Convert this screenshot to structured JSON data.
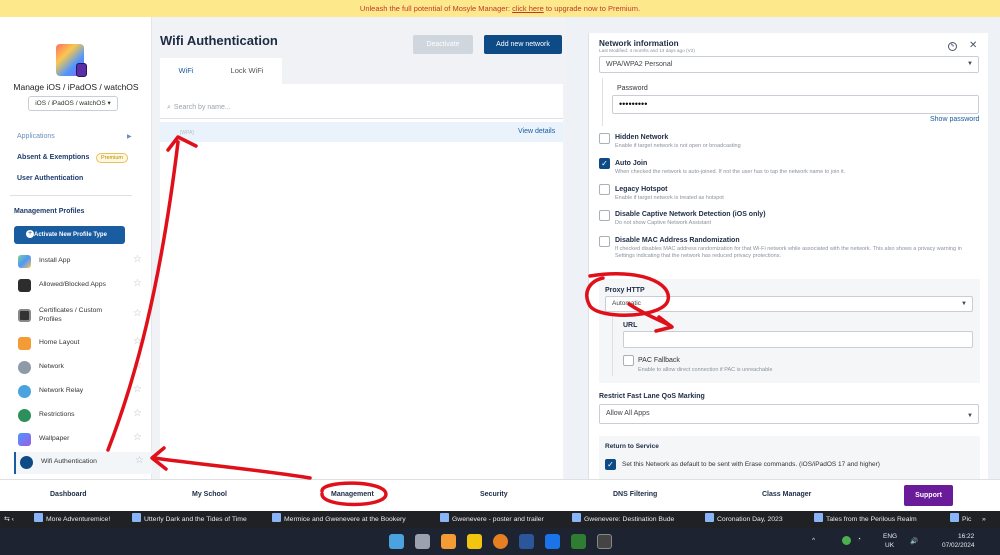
{
  "banner": {
    "pre": "Unleash the full potential of Mosyle Manager: ",
    "link": "click here",
    "post": " to upgrade now to Premium."
  },
  "sidebar": {
    "title": "Manage iOS / iPadOS / watchOS",
    "select": "iOS / iPadOS / watchOS",
    "links": [
      "Applications",
      "Absent & Exemptions",
      "User Authentication"
    ],
    "premium": "Premium",
    "mgmt_title": "Management Profiles",
    "activate": "Activate New Profile Type",
    "items": [
      "Install App",
      "Allowed/Blocked Apps",
      "Certificates / Custom Profiles",
      "Home Layout",
      "Network",
      "Network Relay",
      "Restrictions",
      "Wallpaper",
      "Wifi Authentication"
    ]
  },
  "center": {
    "title": "Wifi Authentication",
    "deactivate": "Deactivate",
    "add": "Add new network",
    "tabs": [
      "WiFi",
      "Lock WiFi"
    ],
    "search_placeholder": "Search by name...",
    "row_name": "[WPA]",
    "view_details": "View details"
  },
  "right": {
    "title": "Network information",
    "subtitle": "Last Modified: 4 months and 13 days ago (V2)",
    "security": "WPA/WPA2 Personal",
    "password_label": "Password",
    "password_value": "•••••••••",
    "show_password": "Show password",
    "options": [
      {
        "label": "Hidden Network",
        "hint": "Enable if target network is not open or broadcasting",
        "checked": false
      },
      {
        "label": "Auto Join",
        "hint": "When checked the network is auto-joined. If not the user has to tap the network name to join it.",
        "checked": true
      },
      {
        "label": "Legacy Hotspot",
        "hint": "Enable if target network is treated as hotspot",
        "checked": false
      },
      {
        "label": "Disable Captive Network Detection (iOS only)",
        "hint": "Do not show Captive Network Assistant",
        "checked": false
      },
      {
        "label": "Disable MAC Address Randomization",
        "hint": "If checked disables MAC address randomization for that Wi-Fi network while associated with the network. This also shows a privacy warning in Settings indicating that the network has reduced privacy protections.",
        "checked": false
      }
    ],
    "proxy_label": "Proxy HTTP",
    "proxy_value": "Automatic",
    "url_label": "URL",
    "pac_label": "PAC Fallback",
    "pac_hint": "Enable to allow direct connection if PAC is unreachable",
    "qos_label": "Restrict Fast Lane QoS Marking",
    "qos_value": "Allow All Apps",
    "rts_label": "Return to Service",
    "rts_text": "Set this Network as default to be sent with Erase commands. (iOS/iPadOS 17 and higher)"
  },
  "bottom": {
    "nav": [
      "Dashboard",
      "My School",
      "Management",
      "Security",
      "DNS Filtering",
      "Class Manager"
    ],
    "support": "Support"
  },
  "browser_tabs": [
    "More Adventuremice!",
    "Utterly Dark and the Tides of Time",
    "Mermice and Gwenevere at the Bookery",
    "Gwenevere - poster and trailer",
    "Gwenevere: Destination Bude",
    "Coronation Day, 2023",
    "Tales from the Perilous Realm",
    "Pic"
  ],
  "system": {
    "lang": "ENG",
    "region": "UK",
    "time": "16:22",
    "date": "07/02/2024"
  },
  "colors": {
    "brand": "#0d4a86",
    "support": "#6a1b9a",
    "annotation": "#e0101a"
  }
}
